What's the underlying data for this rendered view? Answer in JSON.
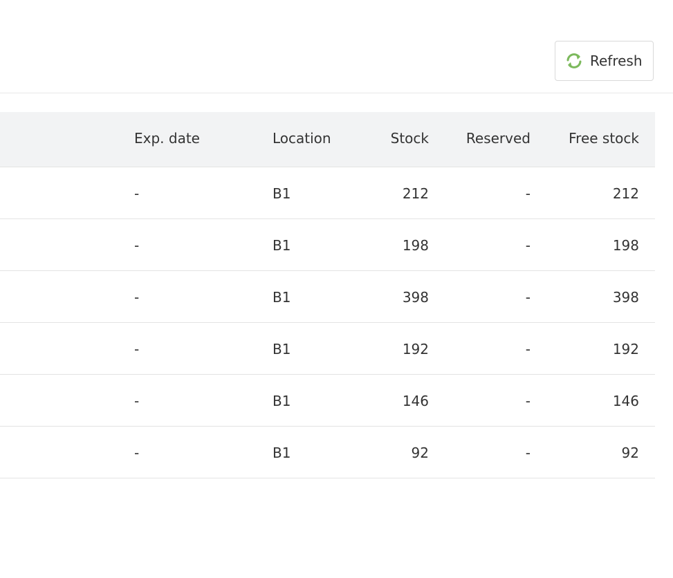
{
  "toolbar": {
    "refresh_label": "Refresh",
    "refresh_icon": "refresh-icon",
    "refresh_icon_color": "#7cb95c"
  },
  "table": {
    "headers": {
      "exp_date": "Exp. date",
      "location": "Location",
      "stock": "Stock",
      "reserved": "Reserved",
      "free_stock": "Free stock"
    },
    "rows": [
      {
        "exp_date": "-",
        "location": "B1",
        "stock": "212",
        "reserved": "-",
        "free_stock": "212"
      },
      {
        "exp_date": "-",
        "location": "B1",
        "stock": "198",
        "reserved": "-",
        "free_stock": "198"
      },
      {
        "exp_date": "-",
        "location": "B1",
        "stock": "398",
        "reserved": "-",
        "free_stock": "398"
      },
      {
        "exp_date": "-",
        "location": "B1",
        "stock": "192",
        "reserved": "-",
        "free_stock": "192"
      },
      {
        "exp_date": "-",
        "location": "B1",
        "stock": "146",
        "reserved": "-",
        "free_stock": "146"
      },
      {
        "exp_date": "-",
        "location": "B1",
        "stock": "92",
        "reserved": "-",
        "free_stock": "92"
      }
    ]
  }
}
